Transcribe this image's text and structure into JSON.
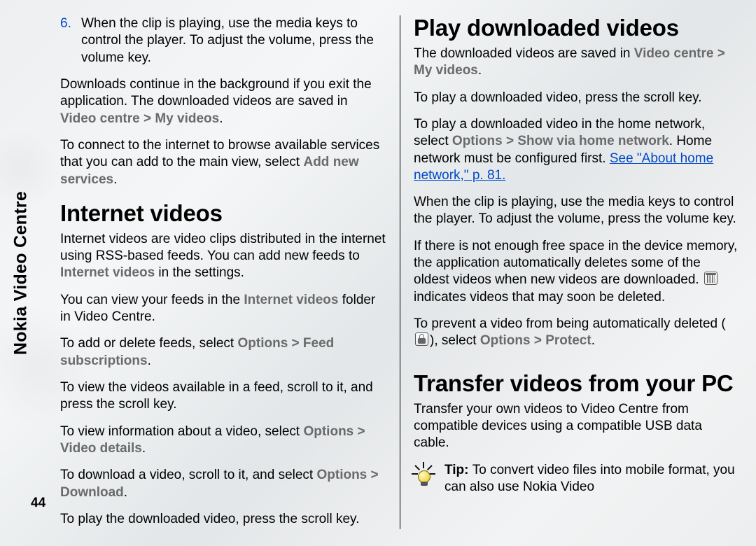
{
  "sidebar": {
    "label": "Nokia Video Centre"
  },
  "page_number": "44",
  "col1": {
    "step6_num": "6.",
    "step6_text": "When the clip is playing, use the media keys to control the player. To adjust the volume, press the volume key.",
    "p_downloads_1": "Downloads continue in the background if you exit the application. The downloaded videos are saved in ",
    "p_downloads_path": "Video centre  >  My videos",
    "p_downloads_2": ".",
    "p_connect_1": "To connect to the internet to browse available services that you can add to the main view, select ",
    "p_connect_bold": "Add new services",
    "p_connect_2": ".",
    "h_internet": "Internet videos",
    "iv_p1_1": "Internet videos are video clips distributed in the internet using RSS-based feeds. You can add new feeds to ",
    "iv_p1_bold": "Internet videos",
    "iv_p1_2": " in the settings.",
    "iv_p2_1": "You can view your feeds in the ",
    "iv_p2_bold": "Internet videos",
    "iv_p2_2": " folder in Video Centre.",
    "iv_p3_1": "To add or delete feeds, select ",
    "iv_p3_bold": "Options  >  Feed subscriptions",
    "iv_p3_2": ".",
    "iv_p4": "To view the videos available in a feed, scroll to it, and press the scroll key.",
    "iv_p5_1": "To view information about a video, select ",
    "iv_p5_bold": "Options  >  Video details",
    "iv_p5_2": ".",
    "iv_p6_1": "To download a video, scroll to it, and select ",
    "iv_p6_bold": "Options  >  Download",
    "iv_p6_2": ".",
    "iv_p7": "To play the downloaded video, press the scroll key."
  },
  "col2": {
    "h_play": "Play downloaded videos",
    "pd_p1_1": "The downloaded videos are saved in ",
    "pd_p1_bold": "Video centre  >  My videos",
    "pd_p1_2": ".",
    "pd_p2": "To play a downloaded video, press the scroll key.",
    "pd_p3_1": "To play a downloaded video in the home network, select ",
    "pd_p3_bold": "Options  >  Show via home network",
    "pd_p3_2": ". Home network must be configured first. ",
    "pd_p3_link": "See \"About home network,\" p. 81.",
    "pd_p4": "When the clip is playing, use the media keys to control the player. To adjust the volume, press the volume key.",
    "pd_p5_1": "If there is not enough free space in the device memory, the application automatically deletes some of the oldest videos when new videos are downloaded. ",
    "pd_p5_2": " indicates videos that may soon be deleted.",
    "pd_p6_1": "To prevent a video from being automatically deleted (",
    "pd_p6_2": "), select ",
    "pd_p6_bold": "Options  >  Protect",
    "pd_p6_3": ".",
    "h_transfer": "Transfer videos from your PC",
    "tr_p1": "Transfer your own videos to Video Centre from compatible devices using a compatible USB data cable.",
    "tip_label": "Tip: ",
    "tip_text": "To convert video files into mobile format, you can also use Nokia Video"
  }
}
